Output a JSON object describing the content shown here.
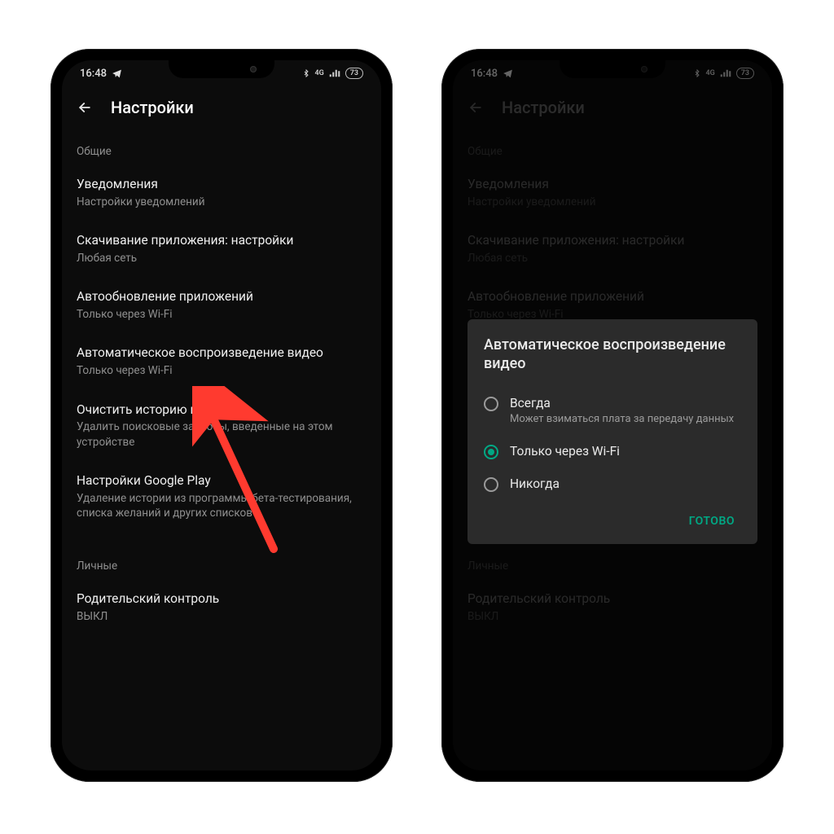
{
  "status": {
    "time": "16:48",
    "network_label": "4G",
    "battery": "73"
  },
  "appbar": {
    "title": "Настройки"
  },
  "sections": {
    "general_header": "Общие",
    "personal_header": "Личные"
  },
  "items": {
    "notifications": {
      "title": "Уведомления",
      "sub": "Настройки уведомлений"
    },
    "download": {
      "title": "Скачивание приложения: настройки",
      "sub": "Любая сеть"
    },
    "autoupdate": {
      "title": "Автообновление приложений",
      "sub": "Только через Wi-Fi"
    },
    "autoplay": {
      "title": "Автоматическое воспроизведение видео",
      "sub": "Только через Wi-Fi"
    },
    "clear_history": {
      "title": "Очистить историю поиска",
      "sub": "Удалить поисковые запросы, введенные на этом устройстве"
    },
    "gplay_settings": {
      "title": "Настройки Google Play",
      "sub": "Удаление истории из программы бета-тестирования, списка желаний и других списков"
    },
    "parental": {
      "title": "Родительский контроль",
      "sub": "ВЫКЛ"
    }
  },
  "dialog": {
    "title": "Автоматическое воспроизведение видео",
    "options": {
      "always": {
        "label": "Всегда",
        "sub": "Может взиматься плата за передачу данных"
      },
      "wifi": {
        "label": "Только через Wi-Fi"
      },
      "never": {
        "label": "Никогда"
      }
    },
    "done": "ГОТОВО"
  },
  "colors": {
    "accent": "#00a884",
    "arrow": "#ff3a2f"
  }
}
